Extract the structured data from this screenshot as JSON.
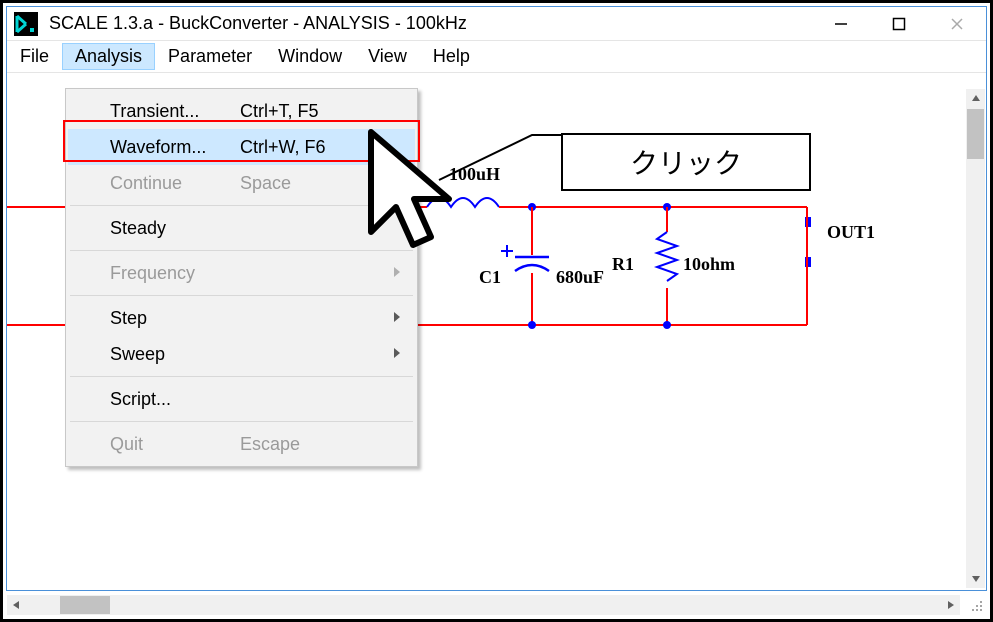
{
  "window": {
    "title": "SCALE 1.3.a - BuckConverter - ANALYSIS - 100kHz"
  },
  "menubar": {
    "items": [
      {
        "label": "File"
      },
      {
        "label": "Analysis"
      },
      {
        "label": "Parameter"
      },
      {
        "label": "Window"
      },
      {
        "label": "View"
      },
      {
        "label": "Help"
      }
    ]
  },
  "analysis_menu": {
    "transient": {
      "label": "Transient...",
      "accel": "Ctrl+T, F5"
    },
    "waveform": {
      "label": "Waveform...",
      "accel": "Ctrl+W, F6"
    },
    "continue": {
      "label": "Continue",
      "accel": "Space"
    },
    "steady": {
      "label": "Steady"
    },
    "frequency": {
      "label": "Frequency"
    },
    "step": {
      "label": "Step"
    },
    "sweep": {
      "label": "Sweep"
    },
    "script": {
      "label": "Script..."
    },
    "quit": {
      "label": "Quit",
      "accel": "Escape"
    }
  },
  "circuit": {
    "inductor_value": "100uH",
    "c_name": "C1",
    "c_value": "680uF",
    "r_name": "R1",
    "r_value": "10ohm",
    "out_label": "OUT1"
  },
  "annotation": {
    "click_label": "クリック"
  }
}
